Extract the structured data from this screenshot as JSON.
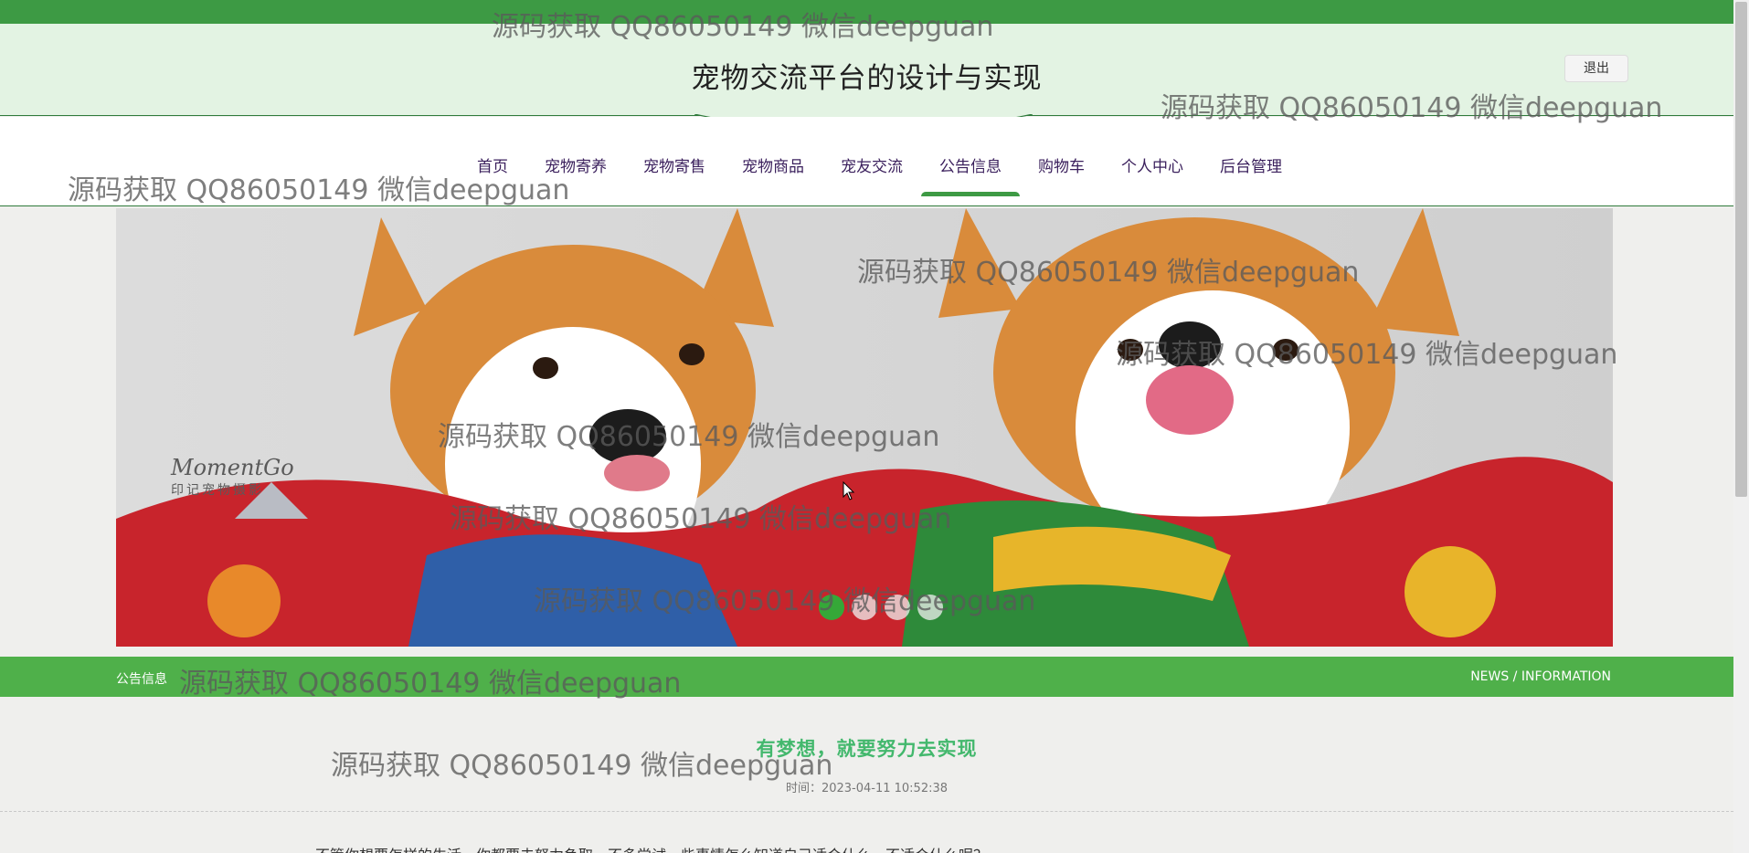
{
  "header": {
    "site_title": "宠物交流平台的设计与实现",
    "logout_label": "退出"
  },
  "nav": {
    "items": [
      {
        "label": "首页"
      },
      {
        "label": "宠物寄养"
      },
      {
        "label": "宠物寄售"
      },
      {
        "label": "宠物商品"
      },
      {
        "label": "宠友交流"
      },
      {
        "label": "公告信息"
      },
      {
        "label": "购物车"
      },
      {
        "label": "个人中心"
      },
      {
        "label": "后台管理"
      }
    ],
    "active_index": 5
  },
  "banner": {
    "logo_text": "MomentGo",
    "logo_subtext": "印记宠物摄影",
    "slide_count": 4,
    "active_slide": 1
  },
  "notice_section": {
    "title": "公告信息",
    "subtitle": "NEWS / INFORMATION"
  },
  "article": {
    "title": "有梦想，就要努力去实现",
    "time": "时间：2023-04-11 10:52:38",
    "body_first_line": "不管你想要怎样的生活，你都要去努力争取，不多尝试一些事情怎么知道自己适合什么、不适合什么呢？"
  },
  "watermark_text": "源码获取 QQ86050149 微信deepguan",
  "colors": {
    "accent_green": "#3d9a44",
    "notice_bar": "#4fb04a",
    "article_title": "#43b86d",
    "nav_text": "#3a1f5c"
  }
}
